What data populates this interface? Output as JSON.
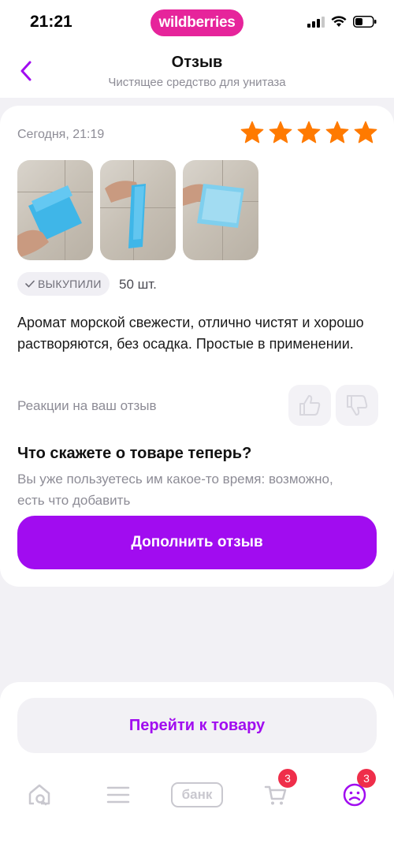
{
  "status_bar": {
    "time": "21:21",
    "brand": "wildberries"
  },
  "header": {
    "title": "Отзыв",
    "subtitle": "Чистящее средство для унитаза"
  },
  "review": {
    "date": "Сегодня, 21:19",
    "rating": 5,
    "rating_max": 5,
    "star_color": "#ff7a00",
    "badge": "ВЫКУПИЛИ",
    "quantity": "50 шт.",
    "text": "Аромат морской свежести, отлично чистят и хорошо растворяются, без осадка. Простые в применении.",
    "reactions_label": "Реакции на ваш отзыв"
  },
  "prompt": {
    "title": "Что скажете о товаре теперь?",
    "subtitle": "Вы уже пользуетесь им какое-то время: возможно, есть что добавить",
    "button": "Дополнить отзыв"
  },
  "bottom": {
    "goto_button": "Перейти к товару",
    "tabs": {
      "bank": "банк",
      "cart_badge": "3",
      "profile_badge": "3"
    }
  },
  "colors": {
    "accent": "#a10cf0",
    "brand": "#e6249b",
    "badge": "#ef2e4a"
  }
}
